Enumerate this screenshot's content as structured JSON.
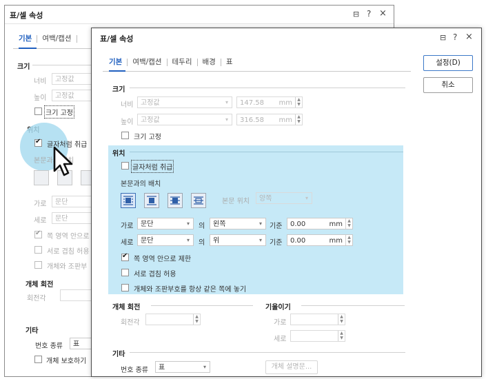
{
  "back": {
    "title": "표/셀 속성",
    "icons": [
      "collapse-icon",
      "help-icon",
      "close-icon"
    ],
    "tabs": {
      "basic": "기본",
      "margin": "여백/캡션"
    },
    "size": {
      "heading": "크기",
      "width": "너비",
      "width_val": "고정값",
      "height": "높이",
      "height_val": "고정값",
      "fix": "크기 고정"
    },
    "pos": {
      "heading": "위치",
      "treat_as_char": "글자처럼 취급",
      "body": "본문과의 배치",
      "horiz": "가로",
      "horiz_val": "문단",
      "vert": "세로",
      "vert_val": "문단",
      "limit": "쪽 영역 안으로",
      "overlap": "서로 겹침 허용",
      "same_page": "개체와 조판부"
    },
    "rot": {
      "heading": "개체 회전",
      "angle": "회전각"
    },
    "etc": {
      "heading": "기타",
      "numtype": "번호 종류",
      "numtype_val": "표",
      "protect": "개체 보호하기"
    }
  },
  "front": {
    "title": "표/셀 속성",
    "tabs": {
      "basic": "기본",
      "margin": "여백/캡션",
      "border": "테두리",
      "bg": "배경",
      "table": "표"
    },
    "buttons": {
      "ok": "설정(D)",
      "cancel": "취소"
    },
    "size": {
      "heading": "크기",
      "width": "너비",
      "width_mode": "고정값",
      "width_val": "147.58",
      "height": "높이",
      "height_mode": "고정값",
      "height_val": "316.58",
      "unit": "mm",
      "fix": "크기 고정"
    },
    "pos": {
      "heading": "위치",
      "treat_as_char": "글자처럼 취급",
      "body": "본문과의 배치",
      "body_pos": "본문 위치",
      "body_pos_val": "양쪽",
      "horiz": "가로",
      "horiz_ref": "문단",
      "horiz_of": "의",
      "horiz_align": "왼쪽",
      "horiz_base": "기준",
      "horiz_val": "0.00",
      "vert": "세로",
      "vert_ref": "문단",
      "vert_of": "의",
      "vert_align": "위",
      "vert_base": "기준",
      "vert_val": "0.00",
      "unit": "mm",
      "limit": "쪽 영역 안으로 제한",
      "overlap": "서로 겹침 허용",
      "same_page": "개체와 조판부호를 항상 같은 쪽에 놓기"
    },
    "rot": {
      "heading": "개체 회전",
      "angle": "회전각"
    },
    "tilt": {
      "heading": "기울이기",
      "horiz": "가로",
      "vert": "세로"
    },
    "etc": {
      "heading": "기타",
      "numtype": "번호 종류",
      "numtype_val": "표",
      "desc_button": "개체 설명문..."
    }
  },
  "colors": {
    "highlight": "#c6e9f7",
    "accent": "#1f5fbf"
  }
}
